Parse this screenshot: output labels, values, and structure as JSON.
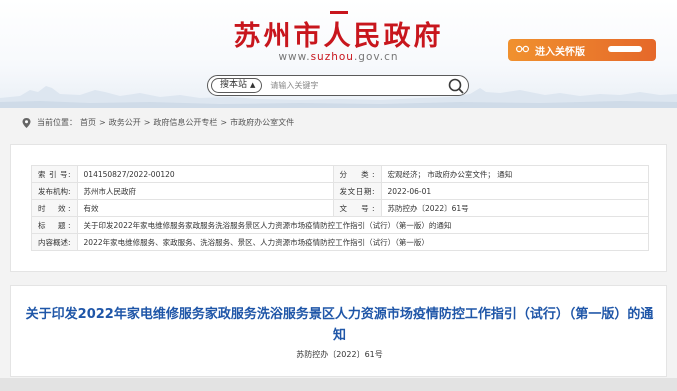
{
  "header": {
    "site_title": "苏州市人民政府",
    "url_prefix": "www.",
    "url_accent": "suzhou",
    "url_suffix": ".gov.cn",
    "care_mode_label": "进入关怀版",
    "care_mode_icon": "glasses-icon"
  },
  "search": {
    "scope_label": "搜本站",
    "placeholder": "请输入关键字"
  },
  "breadcrumb": {
    "prefix": "当前位置：",
    "items": [
      "首页",
      "政务公开",
      "政府信息公开专栏",
      "市政府办公室文件"
    ],
    "separator": ">"
  },
  "info": {
    "index_label": "索 引 号:",
    "index_value": "014150827/2022-00120",
    "category_label": "分　类:",
    "category_value": "宏观经济； 市政府办公室文件； 通知",
    "publisher_label": "发布机构:",
    "publisher_value": "苏州市人民政府",
    "issue_date_label": "发文日期:",
    "issue_date_value": "2022-06-01",
    "validity_label": "时　效:",
    "validity_value": "有效",
    "doc_number_label": "文　号:",
    "doc_number_value": "苏防控办〔2022〕61号",
    "title_label": "标　题:",
    "title_value": "关于印发2022年家电维修服务家政服务洗浴服务景区人力资源市场疫情防控工作指引（试行）（第一版）的通知",
    "summary_label": "内容概述:",
    "summary_value": "2022年家电维修服务、家政服务、洗浴服务、景区、人力资源市场疫情防控工作指引（试行）（第一版）"
  },
  "document": {
    "title": "关于印发2022年家电维修服务家政服务洗浴服务景区人力资源市场疫情防控工作指引（试行）（第一版）的通知",
    "doc_number": "苏防控办〔2022〕61号"
  },
  "colors": {
    "brand_red": "#c8161d",
    "title_blue": "#1f56a8",
    "care_orange": "#e5682a"
  }
}
